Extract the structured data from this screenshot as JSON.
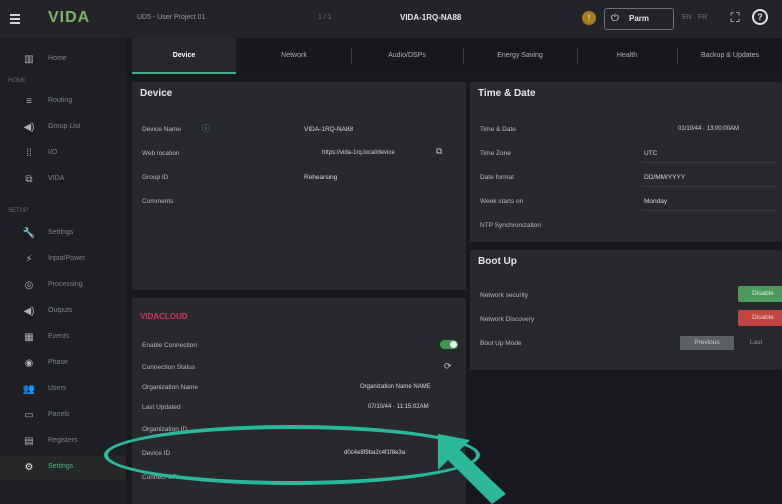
{
  "topbar": {
    "logo": "VIDA",
    "project": "UD5 - User Project 01",
    "center_small": "1 / 1",
    "device_name": "VIDA-1RQ-NA88",
    "warning_glyph": "!",
    "power_label": "Parm",
    "right_small": "EN · FR",
    "icons": [
      "menu-icon",
      "warning-icon",
      "power-icon",
      "expand-icon",
      "help-icon"
    ]
  },
  "sidebar": {
    "sections": [
      "HOME",
      "SETUP"
    ],
    "items": [
      {
        "label": "Home",
        "icon": "chart-icon",
        "glyph": "▥"
      },
      {
        "label": "Routing",
        "icon": "routing-icon",
        "glyph": "≡"
      },
      {
        "label": "Group List",
        "icon": "speaker-icon",
        "glyph": "◀)"
      },
      {
        "label": "I/O",
        "icon": "grid-icon",
        "glyph": "⁞⁞"
      },
      {
        "label": "VIDA",
        "icon": "network-icon",
        "glyph": "⧉"
      },
      {
        "label": "Settings",
        "icon": "wrench-icon",
        "glyph": "🔧"
      },
      {
        "label": "Input/Power",
        "icon": "plug-icon",
        "glyph": "⚡"
      },
      {
        "label": "Processing",
        "icon": "processing-icon",
        "glyph": "◎"
      },
      {
        "label": "Outputs",
        "icon": "output-icon",
        "glyph": "◀)"
      },
      {
        "label": "Events",
        "icon": "calendar-icon",
        "glyph": "▦"
      },
      {
        "label": "Phase",
        "icon": "dial-icon",
        "glyph": "◉"
      },
      {
        "label": "Users",
        "icon": "users-icon",
        "glyph": "👥"
      },
      {
        "label": "Panels",
        "icon": "panel-icon",
        "glyph": "▭"
      },
      {
        "label": "Registers",
        "icon": "document-icon",
        "glyph": "▤"
      },
      {
        "label": "Settings",
        "icon": "gear-icon",
        "glyph": "⚙"
      }
    ]
  },
  "tabs": [
    "Device",
    "Network",
    "Audio/DSPs",
    "Energy Saving",
    "Health",
    "Backup & Updates"
  ],
  "device_panel": {
    "title": "Device",
    "rows": [
      {
        "label": "Device Name",
        "value": "VIDA-1RQ-NA88"
      },
      {
        "label": "Web location",
        "value": "https://vida-1rq.local/device"
      },
      {
        "label": "Group ID",
        "value": "Rehearsing"
      },
      {
        "label": "Comments",
        "value": ""
      }
    ]
  },
  "time_panel": {
    "title": "Time & Date",
    "rows": [
      {
        "label": "Time & Date",
        "value": "01/10/44 · 13:00:00AM"
      },
      {
        "label": "Time Zone",
        "value": "UTC"
      },
      {
        "label": "Date format",
        "value": "DD/MM/YYYY"
      },
      {
        "label": "Week starts on",
        "value": "Monday"
      },
      {
        "label": "NTP Synchronization",
        "value": ""
      }
    ]
  },
  "bootup_panel": {
    "title": "Boot Up",
    "rows": [
      {
        "label": "Network security",
        "button": "Disable"
      },
      {
        "label": "Network Discovery",
        "button": "Disable"
      },
      {
        "label": "Boot Up Mode",
        "seg_on": "Previous",
        "seg_off": "Last"
      }
    ]
  },
  "connect_panel": {
    "title": "VIDACLOUD",
    "rows": [
      {
        "label": "Enable Connection",
        "value": ""
      },
      {
        "label": "Connection Status",
        "value": ""
      },
      {
        "label": "Organization Name",
        "value": "Organization Name NAME"
      },
      {
        "label": "Last Updated",
        "value": "07/10/44 · 11:15:02AM"
      },
      {
        "label": "Organization ID",
        "value": ""
      },
      {
        "label": "Device ID",
        "value": "d0c4e8f9ba2c4f1f8e3a"
      },
      {
        "label": "Connect URL",
        "value": ""
      }
    ]
  },
  "colors": {
    "accent": "#3fae86",
    "highlight": "#2bb79a",
    "danger": "#c0443f",
    "success": "#4d9a5a",
    "section_title": "#d0355f"
  }
}
